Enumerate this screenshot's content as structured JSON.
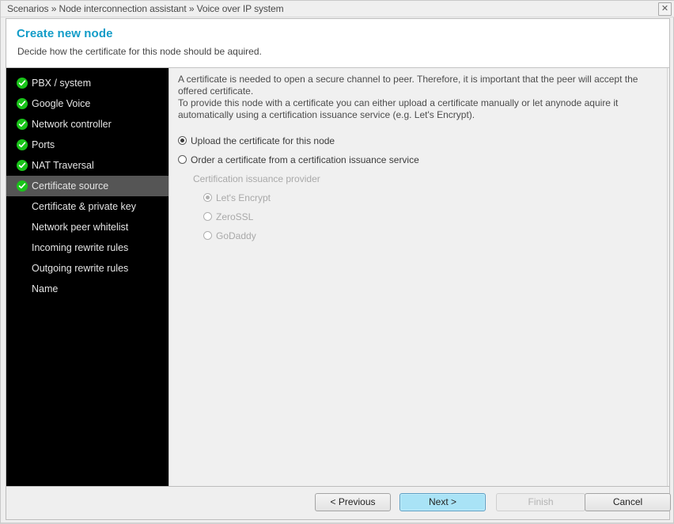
{
  "window": {
    "breadcrumb": "Scenarios » Node interconnection assistant » Voice over IP system",
    "close_label": "✕"
  },
  "header": {
    "title": "Create new node",
    "subtitle": "Decide how the certificate for this node should be aquired.",
    "title_color": "#129cc8"
  },
  "sidebar": {
    "selected_bg": "#555555",
    "items": [
      {
        "label": "PBX / system",
        "completed": true,
        "selected": false
      },
      {
        "label": "Google Voice",
        "completed": true,
        "selected": false
      },
      {
        "label": "Network controller",
        "completed": true,
        "selected": false
      },
      {
        "label": "Ports",
        "completed": true,
        "selected": false
      },
      {
        "label": "NAT Traversal",
        "completed": true,
        "selected": false
      },
      {
        "label": "Certificate source",
        "completed": true,
        "selected": true
      },
      {
        "label": "Certificate & private key",
        "completed": false,
        "selected": false
      },
      {
        "label": "Network peer whitelist",
        "completed": false,
        "selected": false
      },
      {
        "label": "Incoming rewrite rules",
        "completed": false,
        "selected": false
      },
      {
        "label": "Outgoing rewrite rules",
        "completed": false,
        "selected": false
      },
      {
        "label": "Name",
        "completed": false,
        "selected": false
      }
    ]
  },
  "content": {
    "paragraph1": "A certificate is needed to open a secure channel to peer. Therefore, it is important that the peer will accept the offered certificate.",
    "paragraph2": "To provide this node with a certificate you can either upload a certificate manually or let anynode aquire it automatically using a certification issuance service (e.g. Let's Encrypt).",
    "option_upload": "Upload the certificate for this node",
    "option_order": "Order a certificate from a certification issuance service",
    "provider_group_label": "Certification issuance provider",
    "provider_lets_encrypt": "Let's Encrypt",
    "provider_zerossl": "ZeroSSL",
    "provider_godaddy": "GoDaddy"
  },
  "footer": {
    "previous": "< Previous",
    "next": "Next >",
    "finish": "Finish",
    "cancel": "Cancel",
    "next_accent": "#a9e3f6"
  }
}
